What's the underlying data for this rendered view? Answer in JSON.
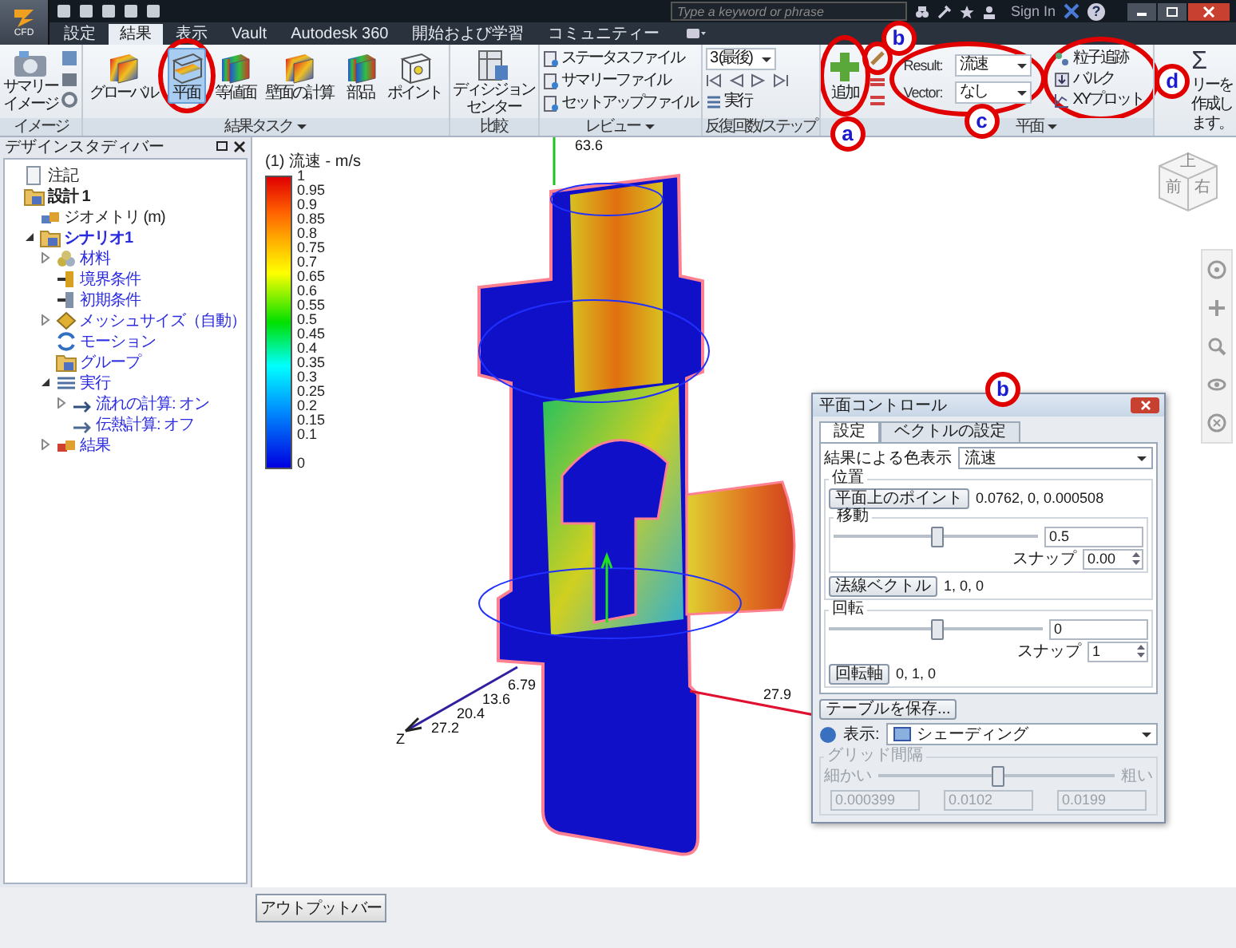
{
  "title_bar": {
    "app_button": "CFD",
    "search": {
      "placeholder": "Type a keyword or phrase"
    },
    "sign_in": "Sign In",
    "help": "?"
  },
  "tabs": [
    {
      "label": "設定",
      "selected": false
    },
    {
      "label": "結果",
      "selected": true
    },
    {
      "label": "表示",
      "selected": false
    },
    {
      "label": "Vault",
      "selected": false
    },
    {
      "label": "Autodesk 360",
      "selected": false
    },
    {
      "label": "開始および学習",
      "selected": false
    },
    {
      "label": "コミュニティー",
      "selected": false
    }
  ],
  "ribbon": {
    "image": {
      "label": "イメージ",
      "summary_image": [
        "サマリー",
        "イメージ"
      ]
    },
    "result_tasks": {
      "label": "結果タスク",
      "buttons": [
        {
          "kind": "global",
          "label": "グローバル",
          "selected": false
        },
        {
          "kind": "plane",
          "label": "平面",
          "selected": true
        },
        {
          "kind": "isosurface",
          "label": "等値面",
          "selected": false
        },
        {
          "kind": "wall",
          "label": "壁面の計算",
          "selected": false
        },
        {
          "kind": "parts",
          "label": "部品",
          "selected": false
        },
        {
          "kind": "point",
          "label": "ポイント",
          "selected": false
        }
      ]
    },
    "compare": {
      "label": "比較",
      "decision_center": [
        "ディシジョン",
        "センター"
      ]
    },
    "review": {
      "label": "レビュー",
      "files": [
        "ステータスファイル",
        "サマリーファイル",
        "セットアップファイル"
      ]
    },
    "iterations": {
      "label": "反復回数/ステップ",
      "step": "3 (最後)",
      "run": "実行"
    },
    "plane": {
      "label": "平面",
      "add": "追加",
      "result": {
        "label": "Result:",
        "value": "流速"
      },
      "vector": {
        "label": "Vector:",
        "value": "なし"
      },
      "tools": [
        {
          "kind": "particle",
          "label": "粒子追跡"
        },
        {
          "kind": "bulk",
          "label": "バルク"
        },
        {
          "kind": "xy",
          "label": "XYプロット"
        }
      ]
    },
    "summary": {
      "icon": "Σ",
      "text": "リーを作成します。"
    }
  },
  "design_study_bar": {
    "title": "デザインスタディバー",
    "tree": [
      {
        "kind": "note",
        "label": "注記"
      },
      {
        "kind": "design",
        "label": "設計 1",
        "children": [
          {
            "kind": "geometry",
            "label": "ジオメトリ (m)"
          },
          {
            "kind": "scenario",
            "label": "シナリオ1",
            "expanded": true,
            "children": [
              {
                "kind": "material",
                "label": "材料",
                "expanded": false
              },
              {
                "kind": "boundary",
                "label": "境界条件"
              },
              {
                "kind": "initial",
                "label": "初期条件"
              },
              {
                "kind": "mesh",
                "label": "メッシュサイズ（自動）",
                "expanded": false
              },
              {
                "kind": "motion",
                "label": "モーション"
              },
              {
                "kind": "group",
                "label": "グループ"
              },
              {
                "kind": "run",
                "label": "実行",
                "expanded": true,
                "children": [
                  {
                    "kind": "flow",
                    "label": "流れの計算: オン",
                    "expanded": false
                  },
                  {
                    "kind": "heat",
                    "label": "伝熱計算: オフ"
                  }
                ]
              },
              {
                "kind": "results",
                "label": "結果",
                "expanded": false
              }
            ]
          }
        ]
      }
    ]
  },
  "viewport": {
    "legend": {
      "title": "(1) 流速 - m/s",
      "ticks": [
        "1",
        "0.95",
        "0.9",
        "0.85",
        "0.8",
        "0.75",
        "0.7",
        "0.65",
        "0.6",
        "0.55",
        "0.5",
        "0.45",
        "0.4",
        "0.35",
        "0.3",
        "0.25",
        "0.2",
        "0.15",
        "0.1",
        "0"
      ]
    },
    "axis_labels": [
      "63.6",
      "6.79",
      "13.6",
      "20.4",
      "27.2",
      "27.9"
    ],
    "axis_name": "Z",
    "view_cube": [
      "上",
      "前",
      "右"
    ]
  },
  "plane_control": {
    "title": "平面コントロール",
    "tabs": [
      {
        "label": "設定",
        "selected": true
      },
      {
        "label": "ベクトルの設定",
        "selected": false
      }
    ],
    "color_by": {
      "label": "結果による色表示",
      "value": "流速"
    },
    "position": {
      "label": "位置",
      "point_button": "平面上のポイント",
      "point_value": "0.0762, 0, 0.000508",
      "move": {
        "label": "移動",
        "level": 0.5,
        "value": "0.5",
        "snap_label": "スナップ",
        "snap_value": "0.00"
      },
      "normal_button": "法線ベクトル",
      "normal_value": "1, 0, 0"
    },
    "rotation": {
      "label": "回転",
      "level": 0.5,
      "value": "0",
      "snap_label": "スナップ",
      "snap_value": "1",
      "axis_button": "回転軸",
      "axis_value": "0, 1, 0"
    },
    "save_table": "テーブルを保存...",
    "display": {
      "label": "表示:",
      "value": "シェーディング"
    },
    "grid_spacing": {
      "label": "グリッド間隔",
      "fine": "細かい",
      "coarse": "粗い",
      "level": 0.5,
      "disabled": true,
      "values": [
        "0.000399",
        "0.0102",
        "0.0199"
      ]
    }
  },
  "output_bar": "アウトプットバー",
  "callouts": [
    "a",
    "b",
    "c",
    "d",
    "b"
  ]
}
